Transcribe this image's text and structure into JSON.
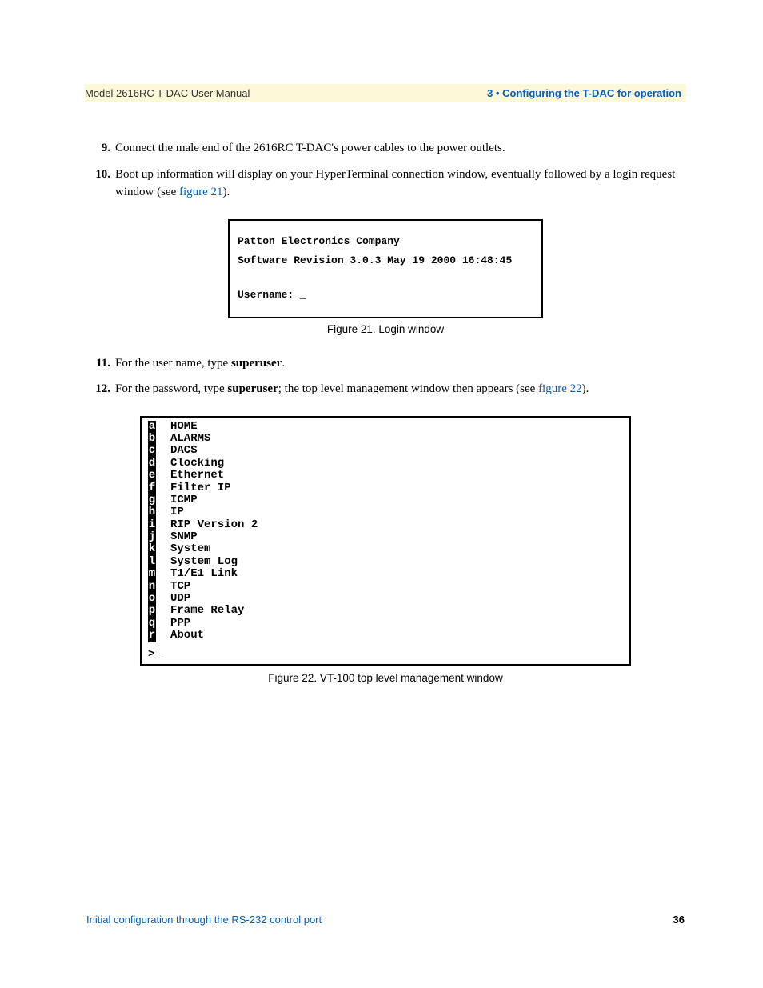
{
  "header": {
    "left": "Model 2616RC T-DAC User Manual",
    "right": "3 • Configuring the T-DAC for operation"
  },
  "steps": {
    "s9": {
      "num": "9.",
      "text": "Connect the male end of the 2616RC T-DAC's power cables to the power outlets."
    },
    "s10": {
      "num": "10.",
      "pre": "Boot up information will display on your HyperTerminal connection window, eventually followed by a login request window (see ",
      "link": "figure 21",
      "post": ")."
    },
    "s11": {
      "num": "11.",
      "pre": "For the user name, type ",
      "bold": "superuser",
      "post": "."
    },
    "s12": {
      "num": "12.",
      "pre": "For the password, type ",
      "bold": "superuser",
      "mid": "; the top level management window then appears (see ",
      "link": "figure 22",
      "post": ")."
    }
  },
  "figure21": {
    "line1": "Patton Electronics Company",
    "line2": "Software Revision 3.0.3 May 19 2000 16:48:45",
    "line3": "Username: _",
    "caption": "Figure 21. Login window"
  },
  "figure22": {
    "items": [
      {
        "key": "a",
        "label": "HOME"
      },
      {
        "key": "b",
        "label": "ALARMS"
      },
      {
        "key": "c",
        "label": "DACS"
      },
      {
        "key": "d",
        "label": "Clocking"
      },
      {
        "key": "e",
        "label": "Ethernet"
      },
      {
        "key": "f",
        "label": "Filter IP"
      },
      {
        "key": "g",
        "label": "ICMP"
      },
      {
        "key": "h",
        "label": "IP"
      },
      {
        "key": "i",
        "label": "RIP Version 2"
      },
      {
        "key": "j",
        "label": "SNMP"
      },
      {
        "key": "k",
        "label": "System"
      },
      {
        "key": "l",
        "label": "System Log"
      },
      {
        "key": "m",
        "label": "T1/E1 Link"
      },
      {
        "key": "n",
        "label": "TCP"
      },
      {
        "key": "o",
        "label": "UDP"
      },
      {
        "key": "p",
        "label": "Frame Relay"
      },
      {
        "key": "q",
        "label": "PPP"
      },
      {
        "key": "r",
        "label": "About"
      }
    ],
    "prompt": ">_",
    "caption": "Figure 22. VT-100 top level management window"
  },
  "footer": {
    "left": "Initial configuration through the RS-232 control port",
    "right": "36"
  }
}
